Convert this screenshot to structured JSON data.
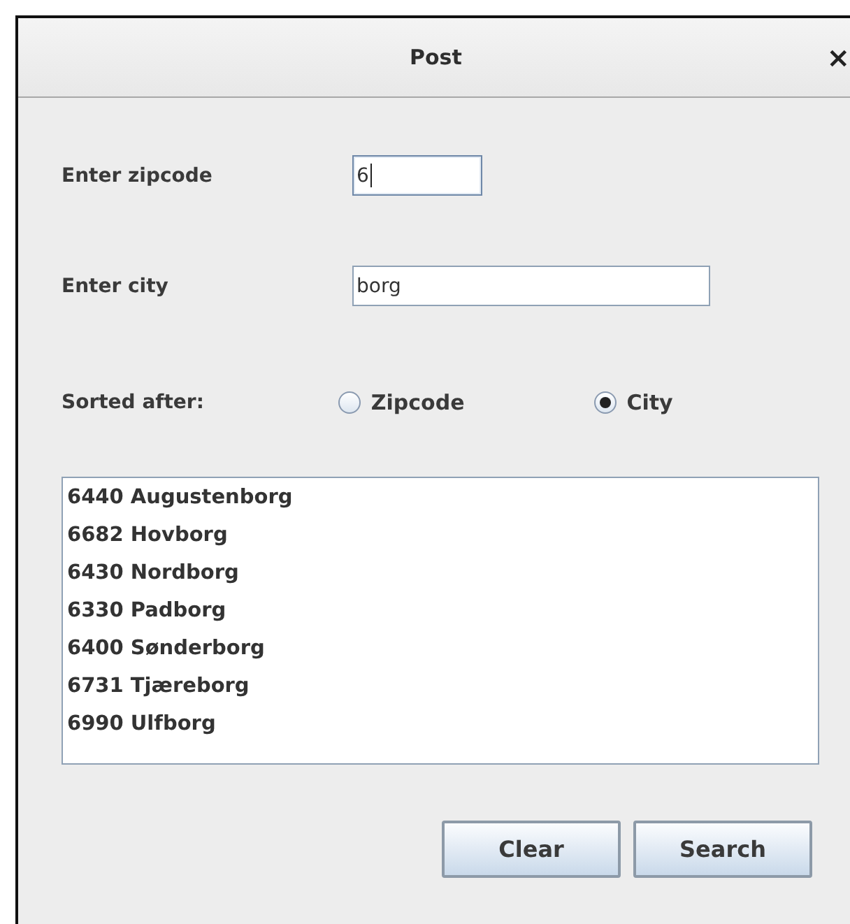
{
  "window": {
    "title": "Post",
    "close": "×"
  },
  "fields": [
    {
      "label": "Enter zipcode",
      "value": "6",
      "focused": true
    },
    {
      "label": "Enter city",
      "value": "borg",
      "focused": false
    }
  ],
  "sort": {
    "label": "Sorted after:",
    "options": [
      {
        "label": "Zipcode",
        "selected": false
      },
      {
        "label": "City",
        "selected": true
      }
    ]
  },
  "results": [
    "6440 Augustenborg",
    "6682 Hovborg",
    "6430 Nordborg",
    "6330 Padborg",
    "6400 Sønderborg",
    "6731 Tjæreborg",
    "6990 Ulfborg"
  ],
  "buttons": [
    "Clear",
    "Search"
  ]
}
